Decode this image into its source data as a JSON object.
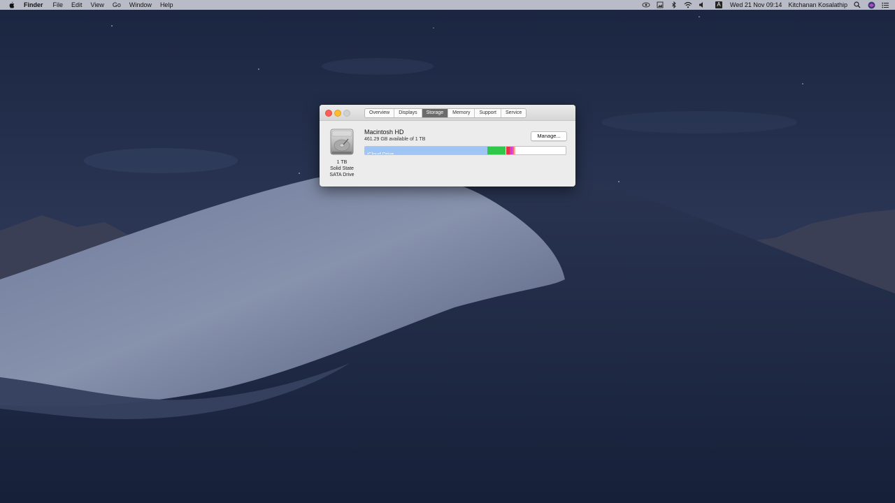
{
  "menubar": {
    "app_name": "Finder",
    "menus": [
      "File",
      "Edit",
      "View",
      "Go",
      "Window",
      "Help"
    ],
    "datetime": "Wed 21 Nov  09:14",
    "user": "Kitchanan Kosalathip",
    "input_source": "A",
    "status_icons": [
      "eye-icon",
      "image-icon",
      "bluetooth-icon",
      "wifi-icon",
      "volume-icon",
      "input-source-icon",
      "search-icon",
      "siri-icon",
      "notification-center-icon"
    ]
  },
  "window": {
    "tabs": [
      {
        "label": "Overview",
        "active": false
      },
      {
        "label": "Displays",
        "active": false
      },
      {
        "label": "Storage",
        "active": true
      },
      {
        "label": "Memory",
        "active": false
      },
      {
        "label": "Support",
        "active": false
      },
      {
        "label": "Service",
        "active": false
      }
    ],
    "drive": {
      "capacity": "1 TB",
      "type": "Solid State",
      "interface": "SATA Drive"
    },
    "disk_name": "Macintosh HD",
    "available": "461.29 GB available of 1 TB",
    "manage_label": "Manage...",
    "storage_bar": {
      "label": "iCloud Drive",
      "segments": [
        {
          "name": "iCloud Drive",
          "fraction": 0.61,
          "color": "#9fc5f5"
        },
        {
          "name": "",
          "fraction": 0.09,
          "color": "#2fc84a"
        },
        {
          "name": "",
          "fraction": 0.005,
          "color": "#ffffff"
        },
        {
          "name": "",
          "fraction": 0.018,
          "color": "#e8324c"
        },
        {
          "name": "",
          "fraction": 0.012,
          "color": "#d53fd0"
        },
        {
          "name": "",
          "fraction": 0.006,
          "color": "#f06a6a"
        },
        {
          "name": "",
          "fraction": 0.008,
          "color": "#f6b0a8"
        }
      ]
    }
  }
}
